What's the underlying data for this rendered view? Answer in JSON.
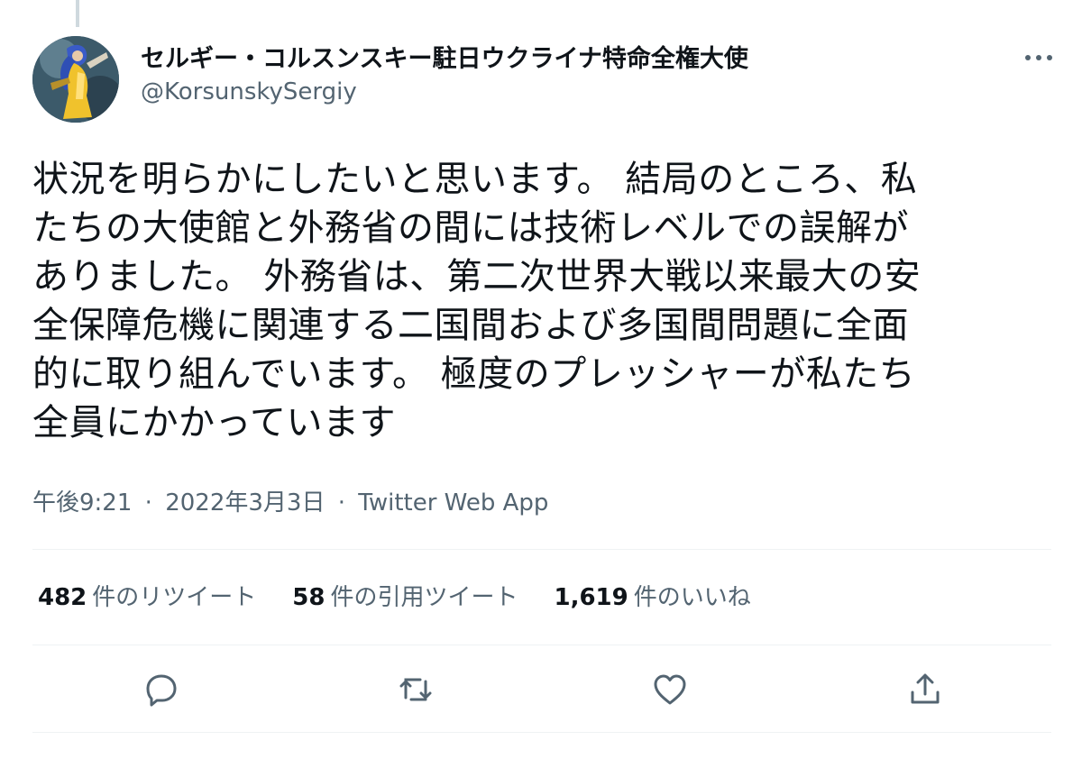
{
  "author": {
    "display_name": "セルギー・コルスンスキー駐日ウクライナ特命全権大使",
    "handle": "@KorsunskySergiy",
    "avatar_icon": "avatar-portrait"
  },
  "tweet": {
    "text": "状況を明らかにしたいと思います。 結局のところ、私\nたちの大使館と外務省の間には技術レベルでの誤解が\nありました。 外務省は、第二次世界大戦以来最大の安\n全保障危機に関連する二国間および多国間問題に全面\n的に取り組んでいます。 極度のプレッシャーが私たち\n全員にかかっています"
  },
  "meta": {
    "time": "午後9:21",
    "date": "2022年3月3日",
    "source": "Twitter Web App",
    "separator": "·"
  },
  "stats": {
    "retweets": {
      "count": "482",
      "label": "件のリツイート"
    },
    "quotes": {
      "count": "58",
      "label": "件の引用ツイート"
    },
    "likes": {
      "count": "1,619",
      "label": "件のいいね"
    }
  },
  "icons": {
    "more": "more-icon",
    "reply": "reply-icon",
    "retweet": "retweet-icon",
    "like": "heart-icon",
    "share": "share-icon"
  },
  "colors": {
    "text": "#0f1419",
    "secondary": "#536471",
    "divider": "#eff3f4"
  }
}
